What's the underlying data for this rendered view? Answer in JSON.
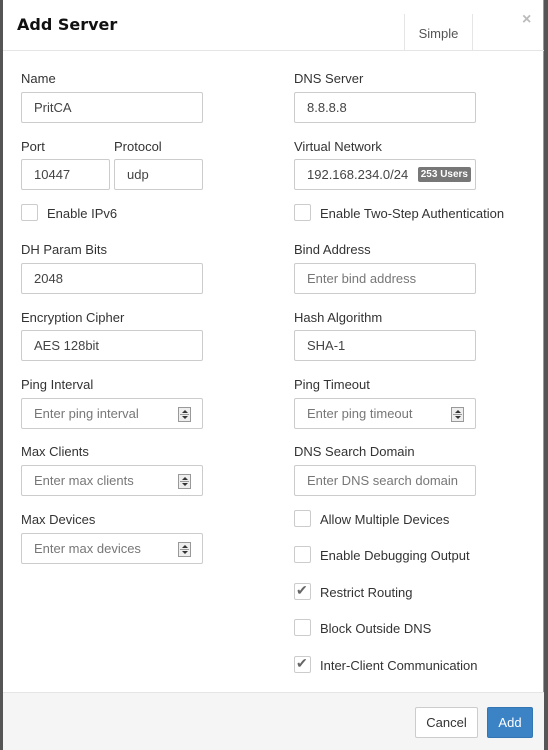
{
  "header": {
    "title": "Add Server",
    "simple_label": "Simple",
    "close_glyph": "×"
  },
  "left": {
    "name": {
      "label": "Name",
      "value": "PritCA"
    },
    "port": {
      "label": "Port",
      "value": "10447"
    },
    "protocol": {
      "label": "Protocol",
      "value": "udp"
    },
    "ipv6": {
      "label": "Enable IPv6",
      "checked": false
    },
    "dh_param": {
      "label": "DH Param Bits",
      "value": "2048"
    },
    "cipher": {
      "label": "Encryption Cipher",
      "value": "AES 128bit"
    },
    "ping_interval": {
      "label": "Ping Interval",
      "placeholder": "Enter ping interval"
    },
    "max_clients": {
      "label": "Max Clients",
      "placeholder": "Enter max clients"
    },
    "max_devices": {
      "label": "Max Devices",
      "placeholder": "Enter max devices"
    }
  },
  "right": {
    "dns_server": {
      "label": "DNS Server",
      "value": "8.8.8.8"
    },
    "virtual_network": {
      "label": "Virtual Network",
      "value": "192.168.234.0/24",
      "badge": "253 Users"
    },
    "two_step": {
      "label": "Enable Two-Step Authentication",
      "checked": false
    },
    "bind_address": {
      "label": "Bind Address",
      "placeholder": "Enter bind address"
    },
    "hash": {
      "label": "Hash Algorithm",
      "value": "SHA-1"
    },
    "ping_timeout": {
      "label": "Ping Timeout",
      "placeholder": "Enter ping timeout"
    },
    "dns_search": {
      "label": "DNS Search Domain",
      "placeholder": "Enter DNS search domain"
    },
    "checkboxes": [
      {
        "label": "Allow Multiple Devices",
        "checked": false
      },
      {
        "label": "Enable Debugging Output",
        "checked": false
      },
      {
        "label": "Restrict Routing",
        "checked": true
      },
      {
        "label": "Block Outside DNS",
        "checked": false
      },
      {
        "label": "Inter-Client Communication",
        "checked": true
      }
    ],
    "check_glyph": "✔"
  },
  "footer": {
    "cancel_label": "Cancel",
    "add_label": "Add"
  }
}
